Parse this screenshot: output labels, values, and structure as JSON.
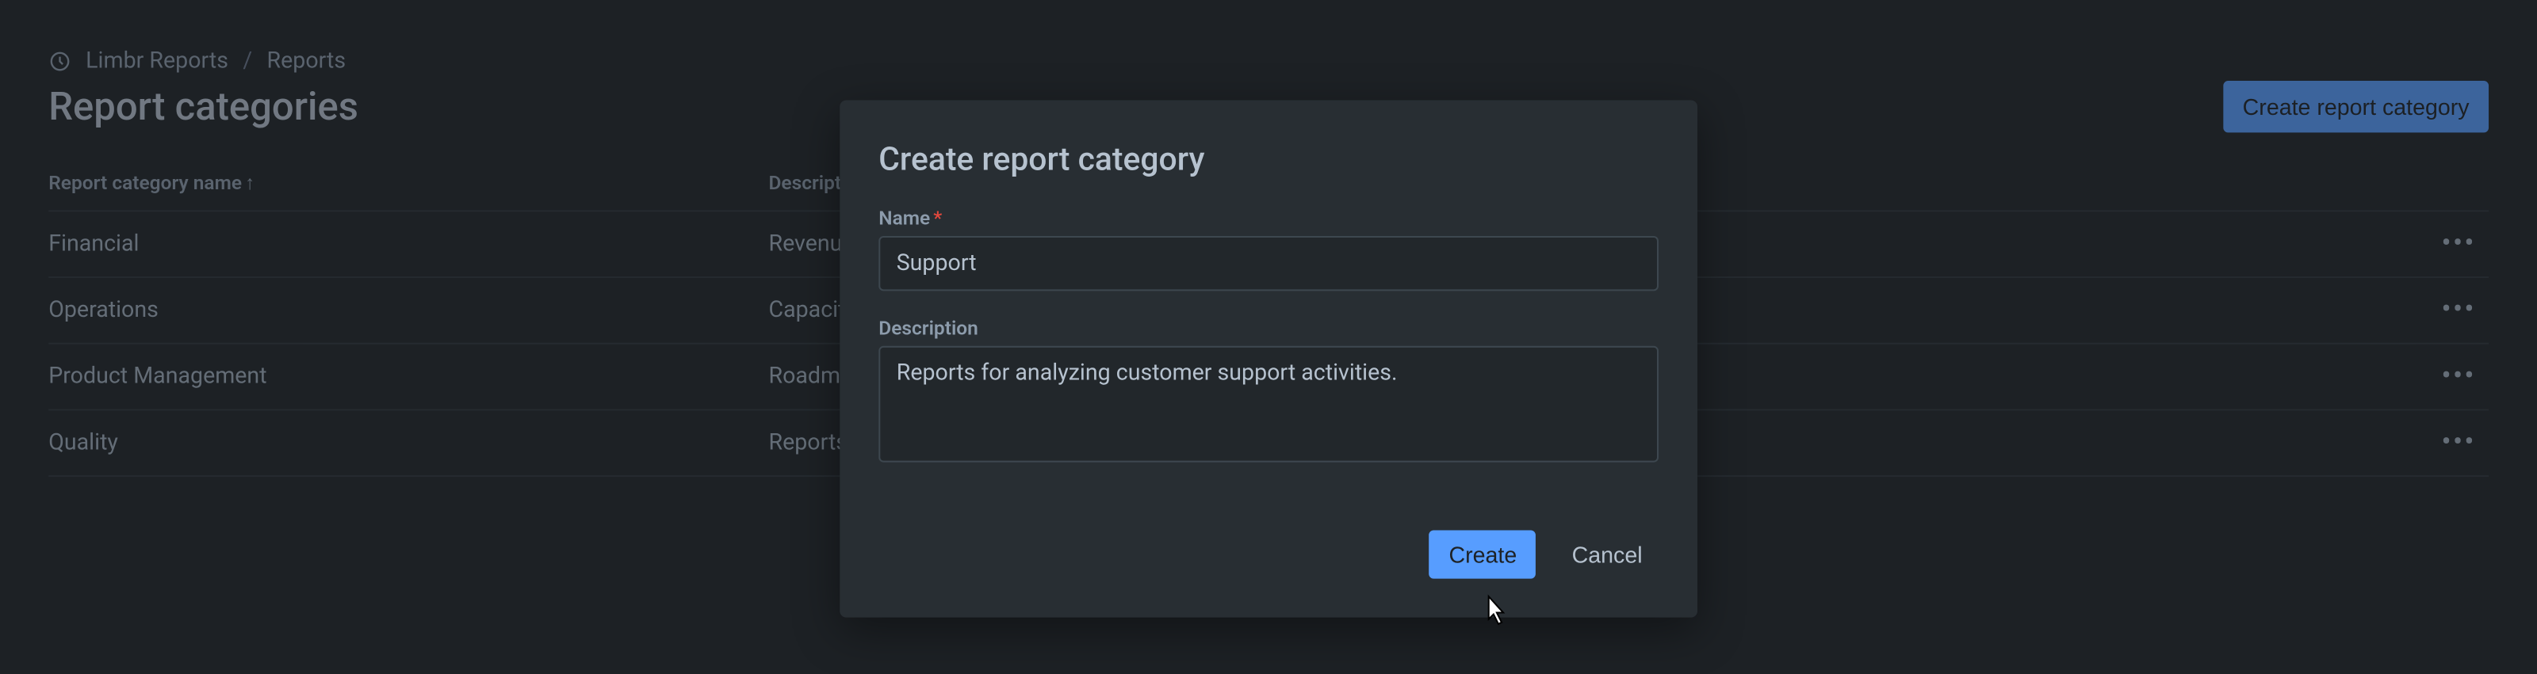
{
  "breadcrumb": {
    "app_name": "Limbr Reports",
    "separator": "/",
    "page": "Reports"
  },
  "header": {
    "title": "Report categories",
    "create_button": "Create report category"
  },
  "table": {
    "columns": {
      "name": "Report category name",
      "sort_indicator": "↑",
      "description": "Description"
    },
    "rows": [
      {
        "name": "Financial",
        "description": "Revenue and profit reports"
      },
      {
        "name": "Operations",
        "description": "Capacity and throughput reports"
      },
      {
        "name": "Product Management",
        "description": "Roadmap and backlog reports"
      },
      {
        "name": "Quality",
        "description": "Reports on quality metrics"
      }
    ]
  },
  "modal": {
    "title": "Create report category",
    "name_label": "Name",
    "name_value": "Support",
    "description_label": "Description",
    "description_value": "Reports for analyzing customer support activities.",
    "create_button": "Create",
    "cancel_button": "Cancel"
  }
}
